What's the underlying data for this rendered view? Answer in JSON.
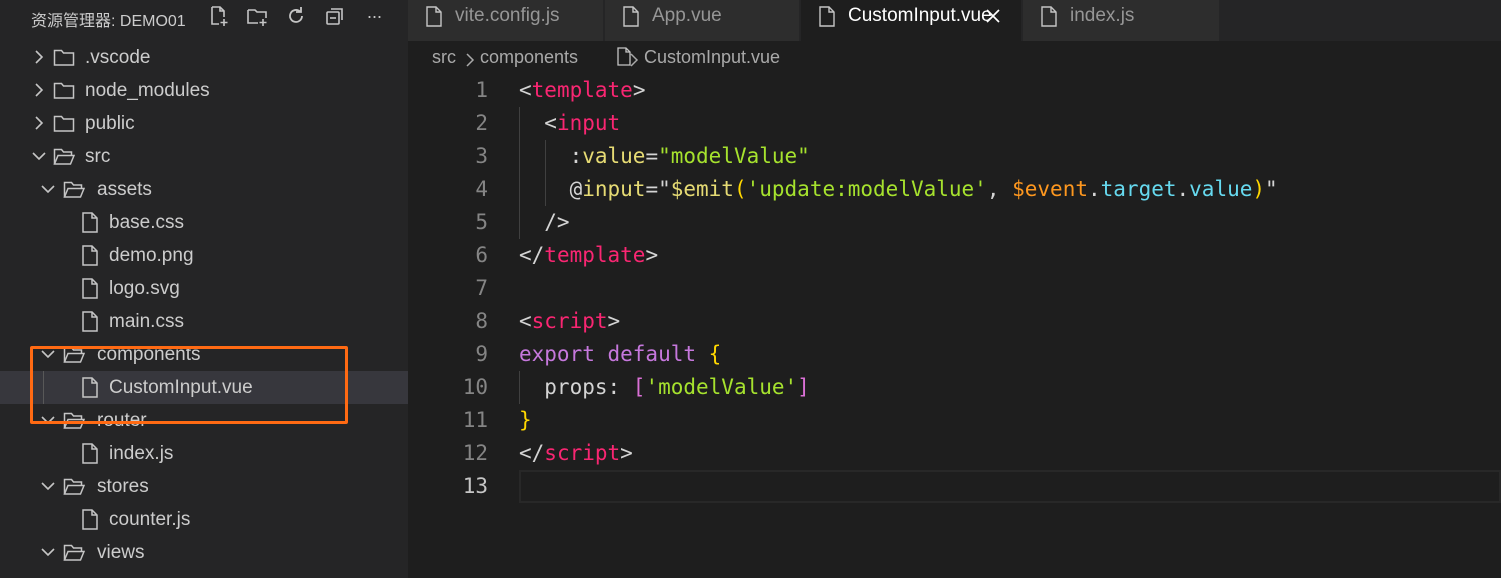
{
  "explorer": {
    "title": "资源管理器: DEMO01",
    "actions": [
      "new-file-icon",
      "new-folder-icon",
      "refresh-icon",
      "collapse-all-icon",
      "more-icon"
    ],
    "more_label": "···",
    "items": [
      {
        "label": ".vscode",
        "type": "folder",
        "expanded": false,
        "depth": 0
      },
      {
        "label": "node_modules",
        "type": "folder",
        "expanded": false,
        "depth": 0
      },
      {
        "label": "public",
        "type": "folder",
        "expanded": false,
        "depth": 0
      },
      {
        "label": "src",
        "type": "folder",
        "expanded": true,
        "depth": 0
      },
      {
        "label": "assets",
        "type": "folder",
        "expanded": true,
        "depth": 1
      },
      {
        "label": "base.css",
        "type": "file",
        "depth": 2
      },
      {
        "label": "demo.png",
        "type": "file",
        "depth": 2
      },
      {
        "label": "logo.svg",
        "type": "file",
        "depth": 2
      },
      {
        "label": "main.css",
        "type": "file",
        "depth": 2
      },
      {
        "label": "components",
        "type": "folder",
        "expanded": true,
        "depth": 1
      },
      {
        "label": "CustomInput.vue",
        "type": "file",
        "depth": 2,
        "selected": true
      },
      {
        "label": "router",
        "type": "folder",
        "expanded": true,
        "depth": 1
      },
      {
        "label": "index.js",
        "type": "file",
        "depth": 2
      },
      {
        "label": "stores",
        "type": "folder",
        "expanded": true,
        "depth": 1
      },
      {
        "label": "counter.js",
        "type": "file",
        "depth": 2
      },
      {
        "label": "views",
        "type": "folder",
        "expanded": true,
        "depth": 1
      }
    ]
  },
  "tabs": [
    {
      "label": "vite.config.js",
      "active": false
    },
    {
      "label": "App.vue",
      "active": false
    },
    {
      "label": "CustomInput.vue",
      "active": true,
      "close": "×"
    },
    {
      "label": "index.js",
      "active": false
    }
  ],
  "breadcrumb": [
    "src",
    "components",
    "CustomInput.vue"
  ],
  "editor": {
    "current_line": 13,
    "lines": [
      {
        "n": "1",
        "tokens": [
          [
            "<",
            "punc"
          ],
          [
            "template",
            "tag"
          ],
          [
            ">",
            "punc"
          ]
        ]
      },
      {
        "n": "2",
        "tokens": [
          [
            "  <",
            "punc"
          ],
          [
            "input",
            "tag"
          ]
        ]
      },
      {
        "n": "3",
        "tokens": [
          [
            "    :",
            "punc"
          ],
          [
            "value",
            "attr"
          ],
          [
            "=",
            "punc"
          ],
          [
            "\"modelValue\"",
            "str"
          ]
        ]
      },
      {
        "n": "4",
        "tokens": [
          [
            "    @",
            "punc"
          ],
          [
            "input",
            "attr"
          ],
          [
            "=\"",
            "punc"
          ],
          [
            "$emit",
            "method"
          ],
          [
            "(",
            "brace"
          ],
          [
            "'update:modelValue'",
            "str"
          ],
          [
            ", ",
            "punc"
          ],
          [
            "$event",
            "var"
          ],
          [
            ".",
            "punc"
          ],
          [
            "target",
            "prop"
          ],
          [
            ".",
            "punc"
          ],
          [
            "value",
            "prop"
          ],
          [
            ")",
            "brace"
          ],
          [
            "\"",
            "punc"
          ]
        ]
      },
      {
        "n": "5",
        "tokens": [
          [
            "  />",
            "punc"
          ]
        ]
      },
      {
        "n": "6",
        "tokens": [
          [
            "</",
            "punc"
          ],
          [
            "template",
            "tag"
          ],
          [
            ">",
            "punc"
          ]
        ]
      },
      {
        "n": "7",
        "tokens": []
      },
      {
        "n": "8",
        "tokens": [
          [
            "<",
            "punc"
          ],
          [
            "script",
            "tag"
          ],
          [
            ">",
            "punc"
          ]
        ]
      },
      {
        "n": "9",
        "tokens": [
          [
            "export default ",
            "kw"
          ],
          [
            "{",
            "brace"
          ]
        ]
      },
      {
        "n": "10",
        "tokens": [
          [
            "  props: ",
            "punc"
          ],
          [
            "[",
            "brack"
          ],
          [
            "'modelValue'",
            "str"
          ],
          [
            "]",
            "brack"
          ]
        ]
      },
      {
        "n": "11",
        "tokens": [
          [
            "}",
            "brace"
          ]
        ]
      },
      {
        "n": "12",
        "tokens": [
          [
            "</",
            "punc"
          ],
          [
            "script",
            "tag"
          ],
          [
            ">",
            "punc"
          ]
        ]
      },
      {
        "n": "13",
        "tokens": []
      }
    ]
  },
  "colors": {
    "highlight_box": "#ff6a13",
    "tag": "#f92672",
    "string": "#a6e22e",
    "keyword": "#c678dd"
  }
}
